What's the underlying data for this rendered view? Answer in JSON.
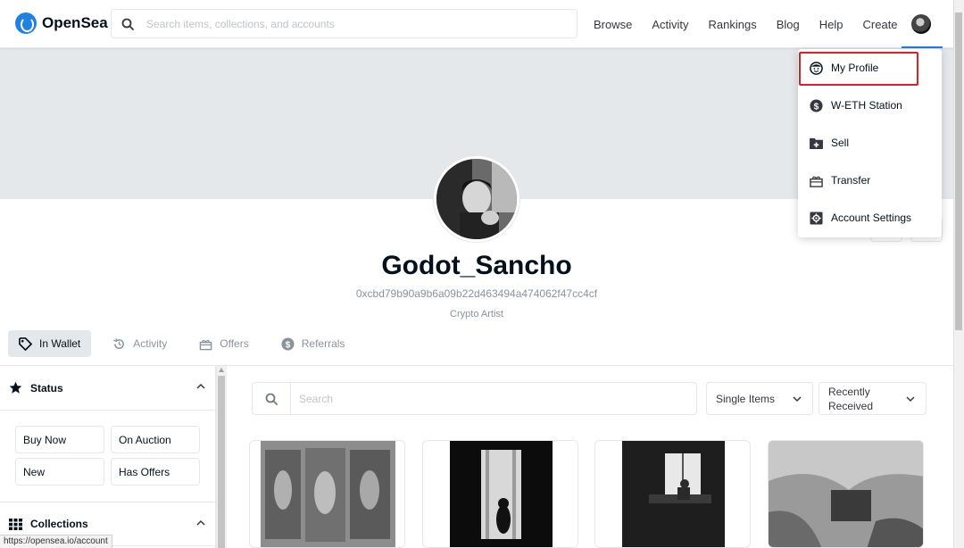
{
  "app": {
    "name": "OpenSea"
  },
  "header": {
    "search_placeholder": "Search items, collections, and accounts",
    "nav": [
      "Browse",
      "Activity",
      "Rankings",
      "Blog",
      "Help",
      "Create"
    ]
  },
  "profile": {
    "username": "Godot_Sancho",
    "address": "0xcbd79b90a9b6a09b22d463494a474062f47cc4cf",
    "bio": "Crypto Artist"
  },
  "tabs": [
    {
      "label": "In Wallet",
      "icon": "tag-icon",
      "active": true
    },
    {
      "label": "Activity",
      "icon": "history-icon",
      "active": false
    },
    {
      "label": "Offers",
      "icon": "offers-icon",
      "active": false
    },
    {
      "label": "Referrals",
      "icon": "dollar-icon",
      "active": false
    }
  ],
  "sidebar": {
    "status": {
      "title": "Status",
      "buttons": [
        "Buy Now",
        "On Auction",
        "New",
        "Has Offers"
      ]
    },
    "collections": {
      "title": "Collections"
    }
  },
  "main": {
    "search_placeholder": "Search",
    "item_type": "Single Items",
    "sort": "Recently Received"
  },
  "dropdown": {
    "items": [
      {
        "label": "My Profile",
        "icon": "profile-icon",
        "highlighted": true
      },
      {
        "label": "W-ETH Station",
        "icon": "dollar-icon"
      },
      {
        "label": "Sell",
        "icon": "sell-folder-icon"
      },
      {
        "label": "Transfer",
        "icon": "gift-icon"
      },
      {
        "label": "Account Settings",
        "icon": "settings-icon"
      }
    ]
  },
  "statusbar": {
    "url": "https://opensea.io/account"
  },
  "colors": {
    "accent": "#2081e2",
    "highlight": "#e02020",
    "banner": "#e5e8eb"
  }
}
